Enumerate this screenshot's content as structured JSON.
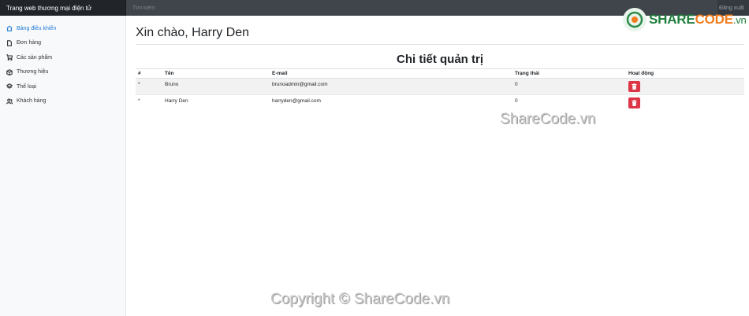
{
  "topbar": {
    "brand": "Trang web thương mại điện tử",
    "search_placeholder": "Tìm kiếm",
    "signout": "Đăng xuất"
  },
  "sidebar": {
    "items": [
      {
        "label": "Bảng điều khiển",
        "icon": "home-icon",
        "active": true
      },
      {
        "label": "Đơn hàng",
        "icon": "file-icon",
        "active": false
      },
      {
        "label": "Các sản phẩm",
        "icon": "cart-icon",
        "active": false
      },
      {
        "label": "Thương hiệu",
        "icon": "box-icon",
        "active": false
      },
      {
        "label": "Thể loại",
        "icon": "layers-icon",
        "active": false
      },
      {
        "label": "Khách hàng",
        "icon": "users-icon",
        "active": false
      }
    ]
  },
  "main": {
    "greeting": "Xin chào, Harry Den",
    "section_title": "Chi tiết quản trị",
    "table": {
      "headers": [
        "#",
        "Tên",
        "E-mail",
        "Trạng thái",
        "Hoạt động"
      ],
      "rows": [
        {
          "idx": "*",
          "name": "Bruno",
          "email": "brunoadmin@gmail.com",
          "status": "0"
        },
        {
          "idx": "*",
          "name": "Harry Den",
          "email": "harryden@gmail.com",
          "status": "0"
        }
      ]
    }
  },
  "colors": {
    "topbar": "#343a40",
    "active_link": "#1e7bd8",
    "delete_button": "#dc3545"
  },
  "watermark": {
    "logo_part1": "SHARE",
    "logo_part2": "CODE",
    "logo_part3": ".vn",
    "center": "ShareCode.vn",
    "footer": "Copyright © ShareCode.vn"
  }
}
